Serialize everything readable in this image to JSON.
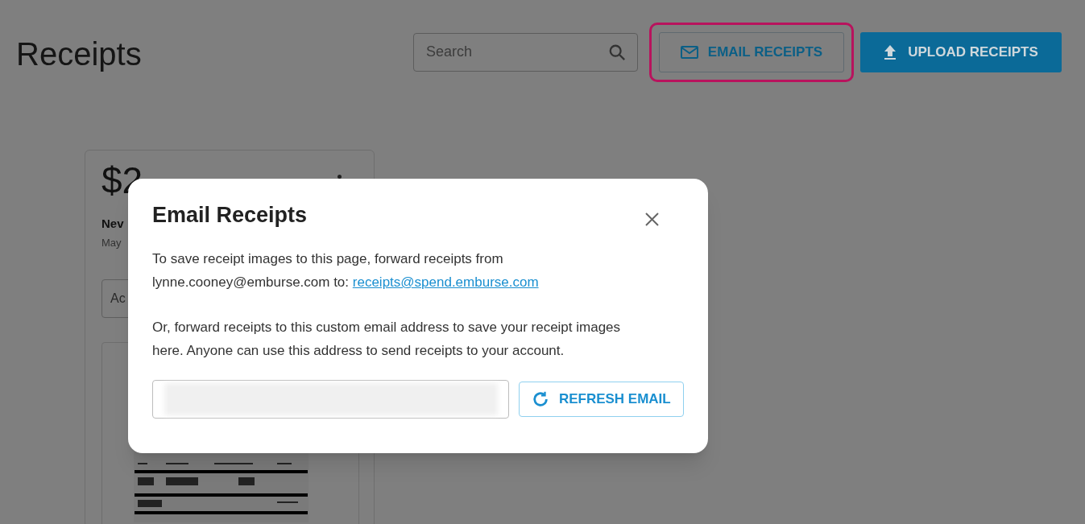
{
  "page": {
    "title": "Receipts",
    "search": {
      "placeholder": "Search"
    },
    "buttons": [
      {
        "label": "EMAIL RECEIPTS",
        "kind": "outline",
        "highlighted": true
      },
      {
        "label": "UPLOAD RECEIPTS",
        "kind": "primary",
        "highlighted": false
      }
    ]
  },
  "receipt_card": {
    "amount": "$2",
    "merchant": "Nev",
    "date": "May",
    "field_placeholder": "Ac"
  },
  "dialog": {
    "title": "Email Receipts",
    "paragraphs": [
      {
        "text": "To save receipt images to this page, forward receipts from lynne.cooney@emburse.com to:",
        "link": "receipts@spend.emburse.com"
      },
      {
        "text": "Or, forward receipts to this custom email address to save your receipt images here. Anyone can use this address to send receipts to your account."
      }
    ],
    "custom_email_field": {
      "redacted": true
    },
    "refresh_button": "REFRESH EMAIL"
  }
}
